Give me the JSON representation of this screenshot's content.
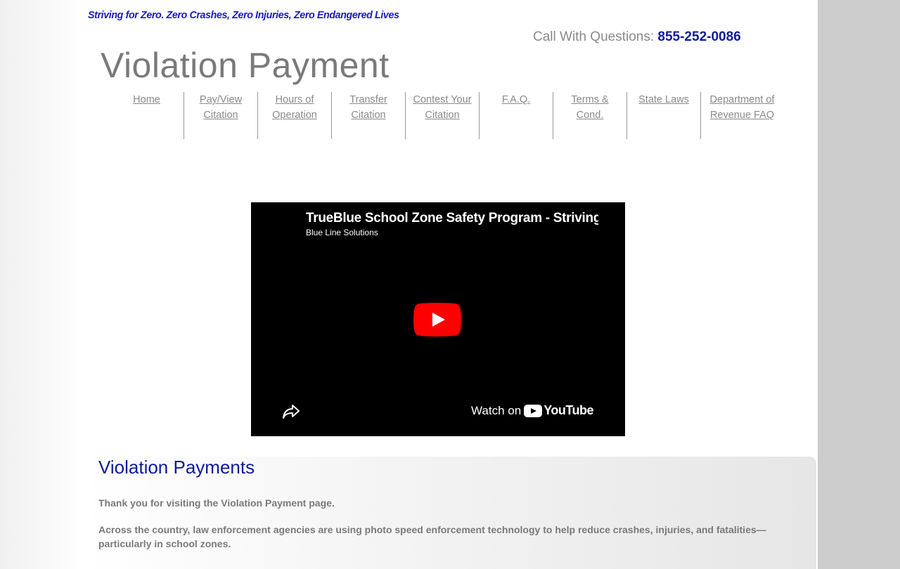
{
  "header": {
    "tagline": "Striving for Zero. Zero Crashes, Zero Injuries, Zero Endangered Lives",
    "call_label": "Call With Questions: ",
    "phone": "855-252-0086",
    "page_title": "Violation Payment"
  },
  "nav": {
    "items": [
      {
        "label": "Home"
      },
      {
        "label": "Pay/View Citation"
      },
      {
        "label": "Hours of Operation"
      },
      {
        "label": "Transfer Citation"
      },
      {
        "label": "Contest Your Citation"
      },
      {
        "label": "F.A.Q."
      },
      {
        "label": "Terms & Cond."
      },
      {
        "label": "State Laws"
      },
      {
        "label": "Department of Revenue FAQ"
      }
    ]
  },
  "video": {
    "title": "TrueBlue School Zone Safety Program - Striving for Zero",
    "channel": "Blue Line Solutions",
    "watch_label": "Watch on",
    "youtube_label": "YouTube",
    "icons": [
      "play-icon",
      "share-icon",
      "youtube-logo-icon"
    ]
  },
  "content": {
    "heading": "Violation Payments",
    "paragraph_1": "Thank you for visiting the Violation Payment page.",
    "paragraph_2": "Across the country, law enforcement agencies are using photo speed enforcement technology to help reduce crashes, injuries, and fatalities—particularly in school zones."
  },
  "colors": {
    "tagline": "#1a1ac4",
    "phone": "#0d1a9c",
    "heading": "#0d1a9c",
    "text_gray": "#7a7a7a",
    "youtube_red": "#ff0000"
  }
}
